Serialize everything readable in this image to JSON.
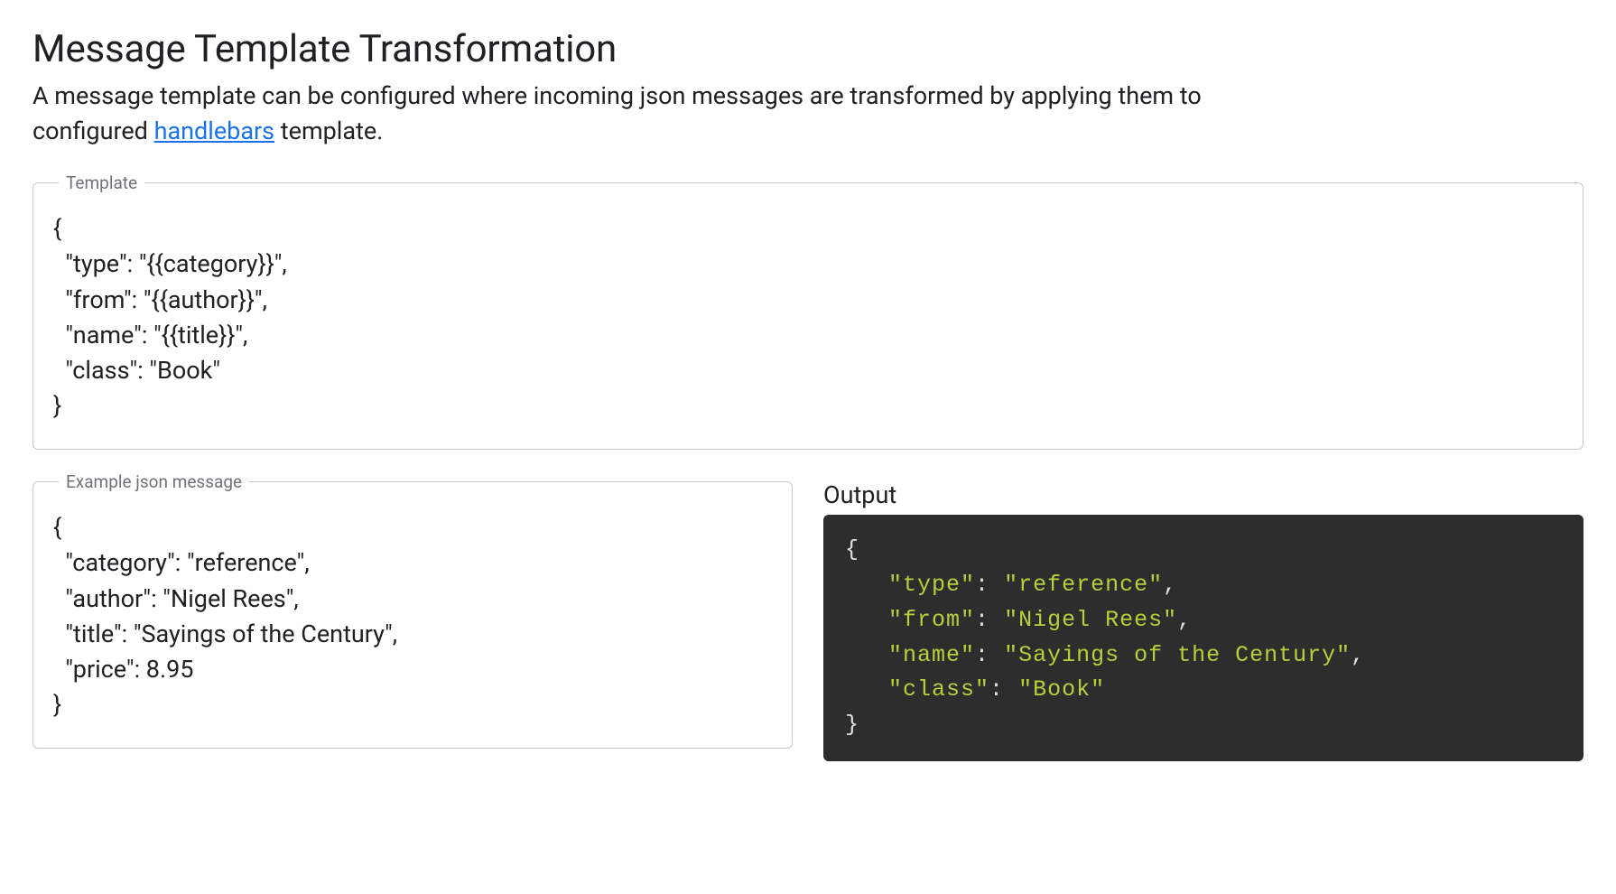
{
  "header": {
    "title": "Message Template Transformation",
    "desc_before": "A message template can be configured where incoming json messages are transformed by applying them to configured ",
    "desc_link": "handlebars",
    "desc_after": " template."
  },
  "template_section": {
    "legend": "Template",
    "value": "{\n  \"type\": \"{{category}}\",\n  \"from\": \"{{author}}\",\n  \"name\": \"{{title}}\",\n  \"class\": \"Book\"\n}"
  },
  "example_section": {
    "legend": "Example json message",
    "value": "{\n  \"category\": \"reference\",\n  \"author\": \"Nigel Rees\",\n  \"title\": \"Sayings of the Century\",\n  \"price\": 8.95\n}"
  },
  "output_section": {
    "label": "Output",
    "json": {
      "type": "reference",
      "from": "Nigel Rees",
      "name": "Sayings of the Century",
      "class": "Book"
    }
  }
}
